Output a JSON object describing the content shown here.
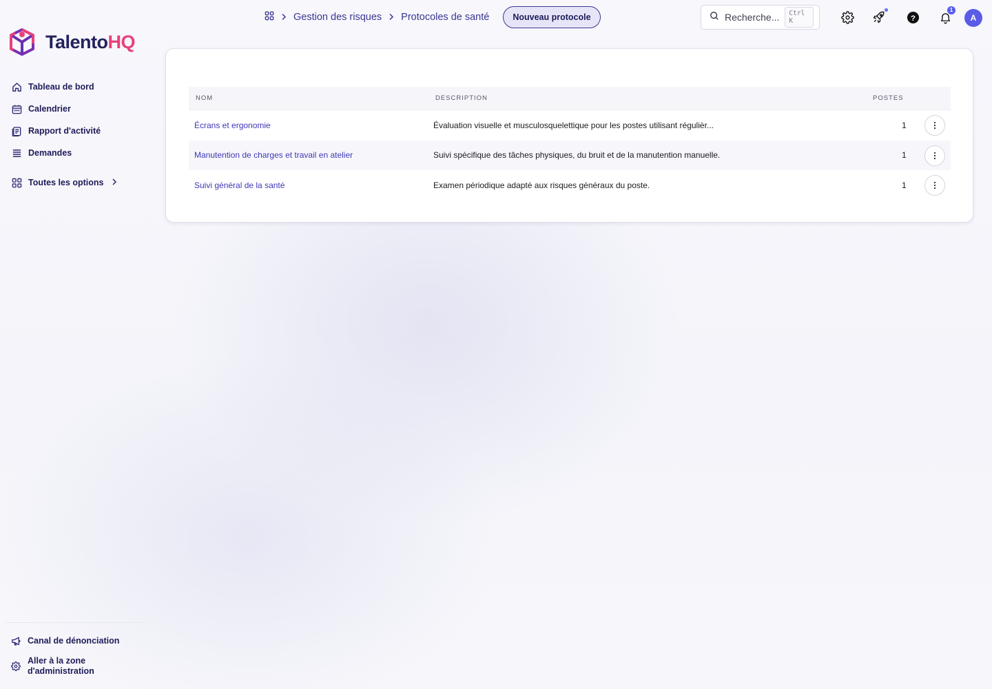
{
  "app": {
    "logo_main": "Talento",
    "logo_accent": "HQ"
  },
  "sidebar": {
    "items": [
      {
        "label": "Tableau de bord",
        "icon": "home-icon"
      },
      {
        "label": "Calendrier",
        "icon": "calendar-icon"
      },
      {
        "label": "Rapport d'activité",
        "icon": "report-icon"
      },
      {
        "label": "Demandes",
        "icon": "list-icon"
      }
    ],
    "all_options": {
      "label": "Toutes les options",
      "icon": "grid-icon"
    },
    "bottom": [
      {
        "label": "Canal de dénonciation",
        "icon": "megaphone-icon"
      },
      {
        "label": "Aller à la zone d'administration",
        "icon": "gear-icon"
      }
    ]
  },
  "header": {
    "breadcrumb": [
      "Gestion des risques",
      "Protocoles de santé"
    ],
    "new_button": "Nouveau protocole",
    "search_placeholder": "Recherche...",
    "search_shortcut": "Ctrl K",
    "notifications_count": "1",
    "avatar_initial": "A"
  },
  "table": {
    "columns": [
      "NOM",
      "DESCRIPTION",
      "POSTES"
    ],
    "rows": [
      {
        "name": "Écrans et ergonomie",
        "description": "Évaluation visuelle et musculosquelettique pour les postes utilisant régulièr...",
        "postes": "1"
      },
      {
        "name": "Manutention de charges et travail en atelier",
        "description": "Suivi spécifique des tâches physiques, du bruit et de la manutention manuelle.",
        "postes": "1"
      },
      {
        "name": "Suivi général de la santé",
        "description": "Examen périodique adapté aux risques généraux du poste.",
        "postes": "1"
      }
    ]
  },
  "colors": {
    "brand_navy": "#24215e",
    "brand_pink": "#e8417a",
    "link": "#3e37b8",
    "accent": "#5b5ce6"
  }
}
